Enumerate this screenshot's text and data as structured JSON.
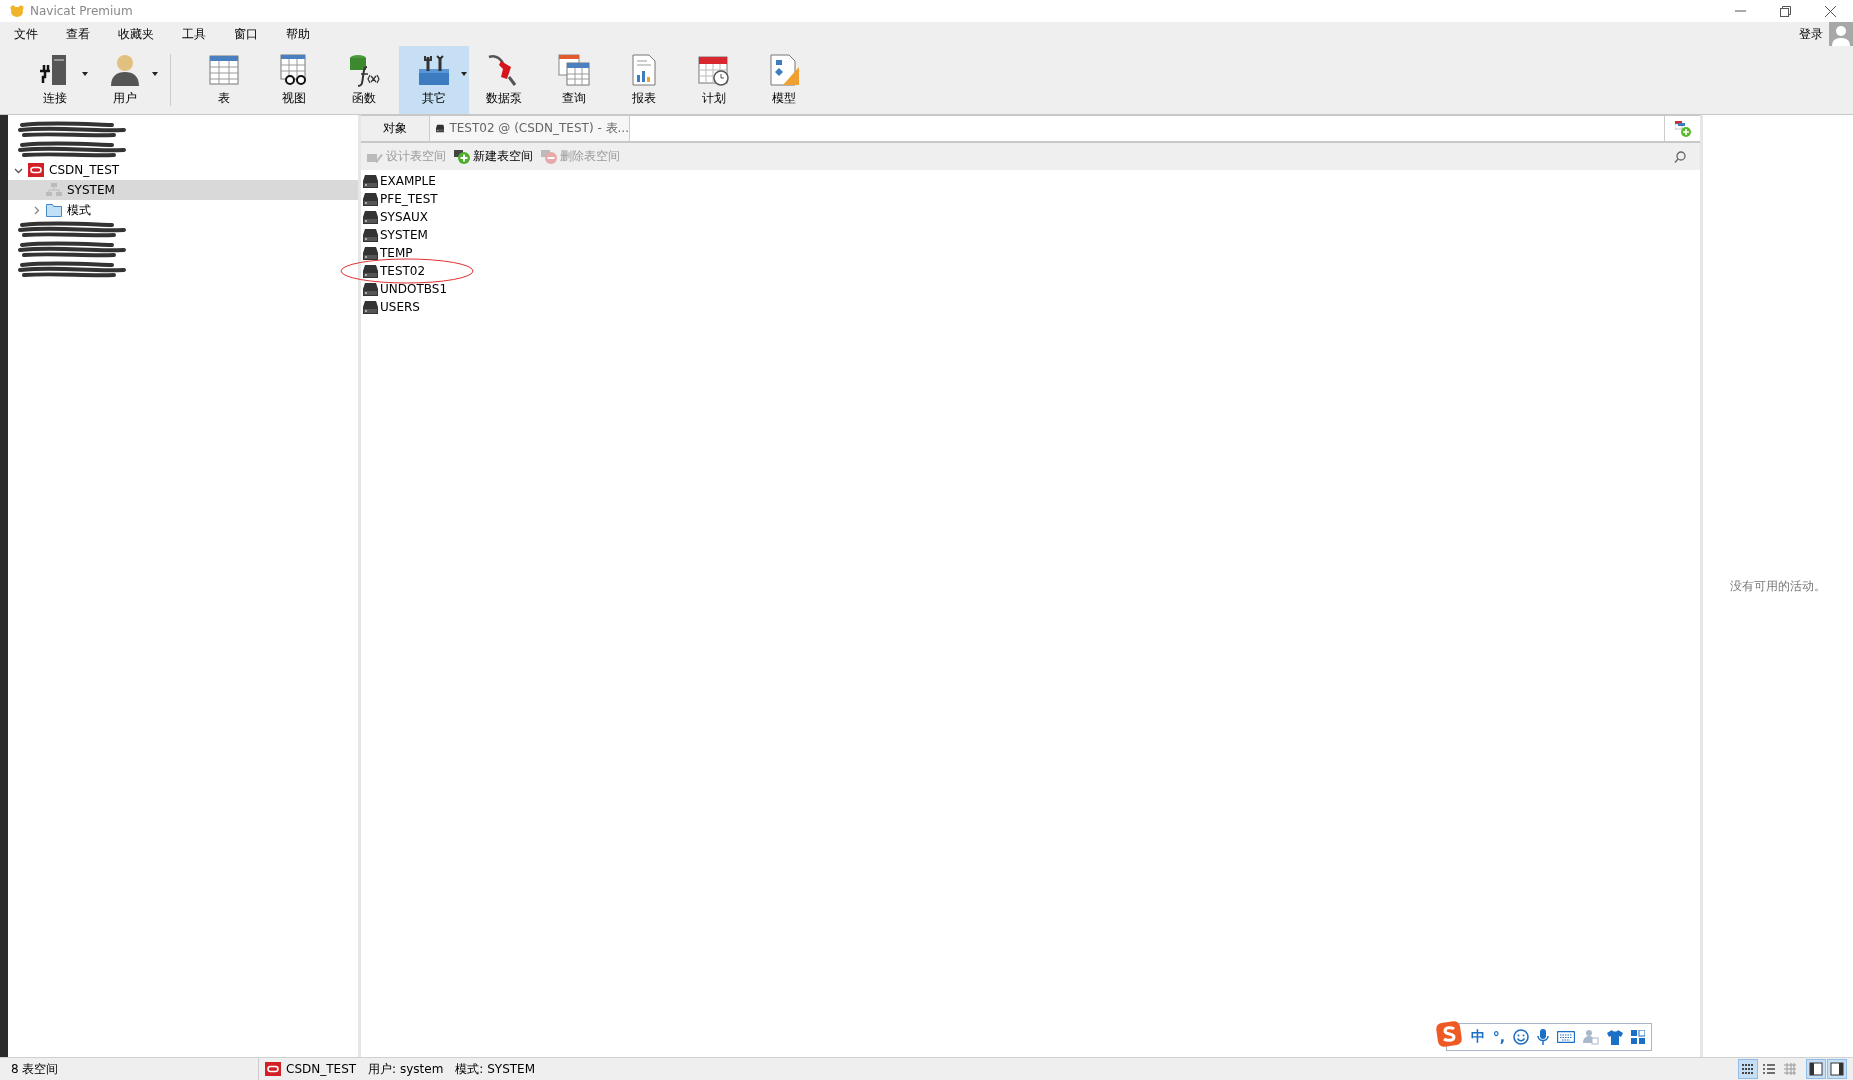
{
  "window": {
    "title": "Navicat Premium"
  },
  "menu": [
    "文件",
    "查看",
    "收藏夹",
    "工具",
    "窗口",
    "帮助"
  ],
  "account": {
    "label": "登录"
  },
  "toolbar": [
    {
      "label": "连接",
      "dropdown": true,
      "selected": false
    },
    {
      "label": "用户",
      "dropdown": true,
      "selected": false
    },
    {
      "label": "表",
      "dropdown": false,
      "selected": false
    },
    {
      "label": "视图",
      "dropdown": false,
      "selected": false
    },
    {
      "label": "函数",
      "dropdown": false,
      "selected": false
    },
    {
      "label": "其它",
      "dropdown": true,
      "selected": true
    },
    {
      "label": "数据泵",
      "dropdown": false,
      "selected": false
    },
    {
      "label": "查询",
      "dropdown": false,
      "selected": false
    },
    {
      "label": "报表",
      "dropdown": false,
      "selected": false
    },
    {
      "label": "计划",
      "dropdown": false,
      "selected": false
    },
    {
      "label": "模型",
      "dropdown": false,
      "selected": false
    }
  ],
  "sidebar": {
    "items": [
      {
        "kind": "redacted"
      },
      {
        "kind": "redacted"
      },
      {
        "kind": "connection",
        "label": "CSDN_TEST",
        "expanded": true,
        "selected": false,
        "children": [
          {
            "kind": "user",
            "label": "SYSTEM",
            "selected": true
          },
          {
            "kind": "folder",
            "label": "模式",
            "expanded": false,
            "selected": false
          }
        ]
      },
      {
        "kind": "redacted"
      },
      {
        "kind": "redacted"
      },
      {
        "kind": "redacted"
      }
    ]
  },
  "tabs": [
    {
      "label": "对象",
      "selected": true,
      "kind": "objects"
    },
    {
      "label": "TEST02 @ (CSDN_TEST) - 表...",
      "selected": false,
      "kind": "document"
    }
  ],
  "object_toolbar": [
    {
      "label": "设计表空间",
      "disabled": true
    },
    {
      "label": "新建表空间",
      "disabled": false
    },
    {
      "label": "删除表空间",
      "disabled": true
    }
  ],
  "tablespaces": [
    {
      "name": "EXAMPLE",
      "circled": false
    },
    {
      "name": "PFE_TEST",
      "circled": false
    },
    {
      "name": "SYSAUX",
      "circled": false
    },
    {
      "name": "SYSTEM",
      "circled": false
    },
    {
      "name": "TEMP",
      "circled": false
    },
    {
      "name": "TEST02",
      "circled": true
    },
    {
      "name": "UNDOTBS1",
      "circled": false
    },
    {
      "name": "USERS",
      "circled": false
    }
  ],
  "activity_panel": {
    "message": "没有可用的活动。"
  },
  "ime_bar": {
    "items": [
      "中",
      "°,"
    ]
  },
  "status_bar": {
    "count": "8 表空间",
    "connection": "CSDN_TEST",
    "user": "用户: system",
    "schema": "模式: SYSTEM",
    "views": [
      {
        "selected": true
      },
      {
        "selected": false
      },
      {
        "selected": false
      }
    ],
    "panes": [
      {
        "on": true
      },
      {
        "on": true
      }
    ]
  }
}
